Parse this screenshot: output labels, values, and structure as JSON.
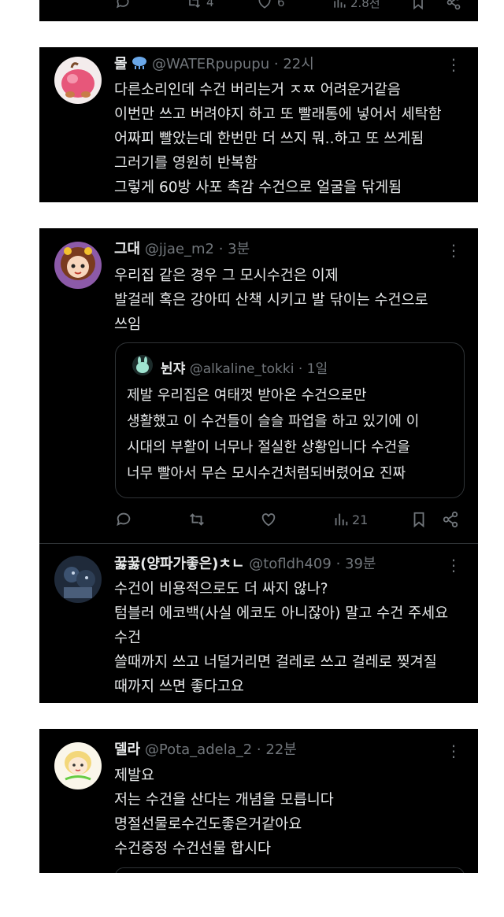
{
  "top_card": {
    "reply_count": "4",
    "like_count": "6",
    "view_count": "2.8천"
  },
  "tweets": [
    {
      "name": "몰",
      "handle": "@WATERpupupu",
      "time": "· 22시",
      "lines": [
        "다른소리인데 수건 버리는거 ㅈㅉ 어려운거같음",
        "이번만 쓰고 버려야지 하고 또 빨래통에 넣어서 세탁함",
        "어짜피 빨았는데 한번만 더 쓰지 뭐..하고 또 쓰게됨",
        "그러기를 영원히 반복함",
        "그렇게 60방 사포 촉감 수건으로 얼굴을 닦게됨"
      ]
    },
    {
      "name": "그대",
      "handle": "@jjae_m2",
      "time": "· 3분",
      "lines": [
        "우리집 같은 경우 그 모시수건은 이제",
        "발걸레 혹은 강아띠 산책 시키고 발 닦이는 수건으로",
        "쓰임"
      ],
      "quote": {
        "name": "뉜쟈",
        "handle": "@alkaline_tokki",
        "time": "· 1일",
        "lines": [
          "제발 우리집은 여태껏 받아온 수건으로만",
          "생활했고 이 수건들이 슬슬 파업을 하고 있기에 이",
          "시대의 부활이 너무나 절실한 상황입니다 수건을",
          "너무 빨아서 무슨 모시수건처럼되버렸어요 진짜"
        ]
      },
      "view_count": "21"
    },
    {
      "name": "꿇꿇(양파가좋은)ㅊㄴ",
      "handle": "@tofldh409",
      "time": "· 39분",
      "lines": [
        "수건이 비용적으로도 더 싸지 않나?",
        "텀블러 에코백(사실 에코도 아니잖아) 말고 수건 주세요",
        "수건",
        "쓸때까지 쓰고 너덜거리면 걸레로 쓰고 걸레로 찢겨질",
        "때까지 쓰면 좋다고요"
      ]
    },
    {
      "name": "델라",
      "handle": "@Pota_adela_2",
      "time": "· 22분",
      "lines": [
        "제발요",
        "저는 수건을 산다는 개념을 모릅니다",
        "명절선물로수건도좋은거같아요",
        "수건증정 수건선물 합시다"
      ]
    }
  ],
  "icons": {
    "more": "more-icon",
    "reply": "reply-icon",
    "retweet": "retweet-icon",
    "like": "like-icon",
    "views": "views-icon",
    "bookmark": "bookmark-icon",
    "share": "share-icon"
  },
  "colors": {
    "background": "#000000",
    "text": "#e7e9ea",
    "muted": "#71767b",
    "border": "#2f3336"
  }
}
